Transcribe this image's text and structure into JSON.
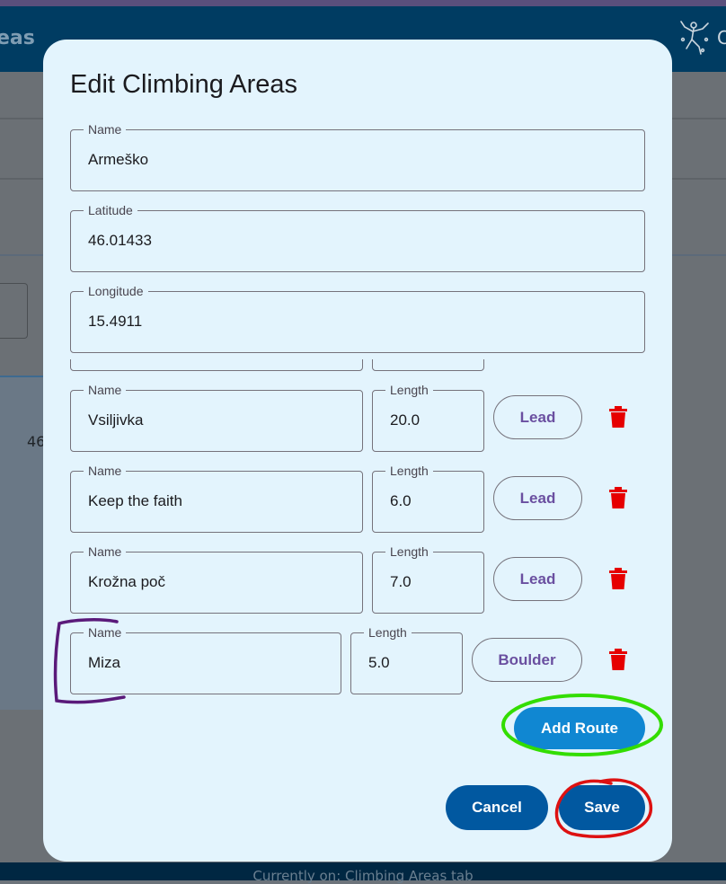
{
  "background": {
    "header_title": "eas",
    "logo_icon": "climber-icon",
    "logo_letter": "C",
    "card_value": "46",
    "footer_text": "Currently on: Climbing Areas tab"
  },
  "dialog": {
    "title": "Edit Climbing Areas",
    "fields": {
      "name": {
        "label": "Name",
        "value": "Armeško"
      },
      "latitude": {
        "label": "Latitude",
        "value": "46.01433"
      },
      "longitude": {
        "label": "Longitude",
        "value": "15.4911"
      }
    },
    "routes": [
      {
        "name_label": "Name",
        "name": "Vsiljivka",
        "length_label": "Length",
        "length": "20.0",
        "type": "Lead"
      },
      {
        "name_label": "Name",
        "name": "Keep the faith",
        "length_label": "Length",
        "length": "6.0",
        "type": "Lead"
      },
      {
        "name_label": "Name",
        "name": "Krožna poč",
        "length_label": "Length",
        "length": "7.0",
        "type": "Lead"
      },
      {
        "name_label": "Name",
        "name": "Miza",
        "length_label": "Length",
        "length": "5.0",
        "type": "Boulder"
      }
    ],
    "add_route_label": "Add Route",
    "cancel_label": "Cancel",
    "save_label": "Save"
  },
  "colors": {
    "dialog_bg": "#e3f4fd",
    "primary": "#0158a0",
    "add_button": "#1087d2",
    "delete_icon": "#e60000",
    "type_button_text": "#6a4fa0",
    "annotation_purple": "#5a1a7a",
    "annotation_green": "#33dd00",
    "annotation_red": "#dd1111"
  }
}
